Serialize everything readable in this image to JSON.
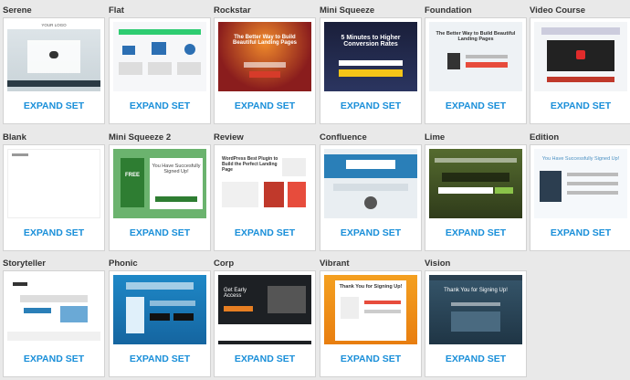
{
  "expand_label": "EXPAND SET",
  "templates": [
    {
      "name": "Serene"
    },
    {
      "name": "Flat"
    },
    {
      "name": "Rockstar"
    },
    {
      "name": "Mini Squeeze"
    },
    {
      "name": "Foundation"
    },
    {
      "name": "Video Course"
    },
    {
      "name": "Blank"
    },
    {
      "name": "Mini Squeeze 2"
    },
    {
      "name": "Review"
    },
    {
      "name": "Confluence"
    },
    {
      "name": "Lime"
    },
    {
      "name": "Edition"
    },
    {
      "name": "Storyteller"
    },
    {
      "name": "Phonic"
    },
    {
      "name": "Corp"
    },
    {
      "name": "Vibrant"
    },
    {
      "name": "Vision"
    }
  ],
  "thumb_text": {
    "serene_logo": "YOUR LOGO",
    "rockstar_headline": "The Better Way to Build Beautiful Landing Pages",
    "mini_squeeze_headline": "5 Minutes to Higher Conversion Rates",
    "foundation_headline": "The Better Way to Build Beautiful Landing Pages",
    "mini_squeeze2_headline": "You Have Succesfully Signed Up!",
    "mini_squeeze2_book": "FREE",
    "review_headline": "WordPress Best Plugin to Build the Perfect Landing Page",
    "edition_headline": "You Have Successfully Signed Up!",
    "vibrant_headline": "Thank You for Signing Up!",
    "vision_headline": "Thank You for Signing Up!",
    "corp_headline": "Get Early Access"
  }
}
